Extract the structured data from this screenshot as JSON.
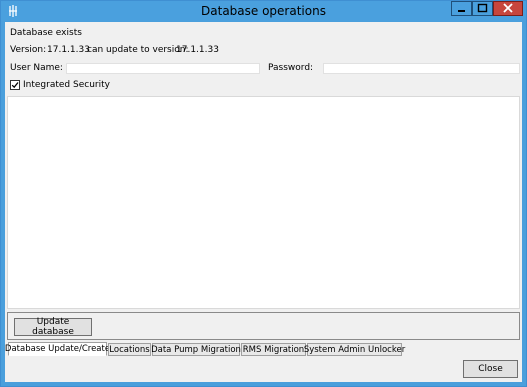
{
  "window": {
    "title": "Database operations"
  },
  "status": {
    "text": "Database exists"
  },
  "version": {
    "label": "Version:",
    "current": "17.1.1.33",
    "update_label": "can update to version:",
    "target": "17.1.1.33"
  },
  "credentials": {
    "user_label": "User Name:",
    "user_value": "",
    "password_label": "Password:",
    "password_value": ""
  },
  "integrated_security": {
    "label": "Integrated Security",
    "checked": true
  },
  "actions": {
    "update_label": "Update database",
    "close_label": "Close"
  },
  "tabs": [
    {
      "label": "Database Update/Create",
      "active": true
    },
    {
      "label": "Locations",
      "active": false
    },
    {
      "label": "Data Pump Migration",
      "active": false
    },
    {
      "label": "RMS Migration",
      "active": false
    },
    {
      "label": "System Admin Unlocker",
      "active": false
    }
  ],
  "colors": {
    "titlebar": "#4aa0de",
    "close_button": "#c7463d",
    "client_bg": "#f0f0f0"
  }
}
